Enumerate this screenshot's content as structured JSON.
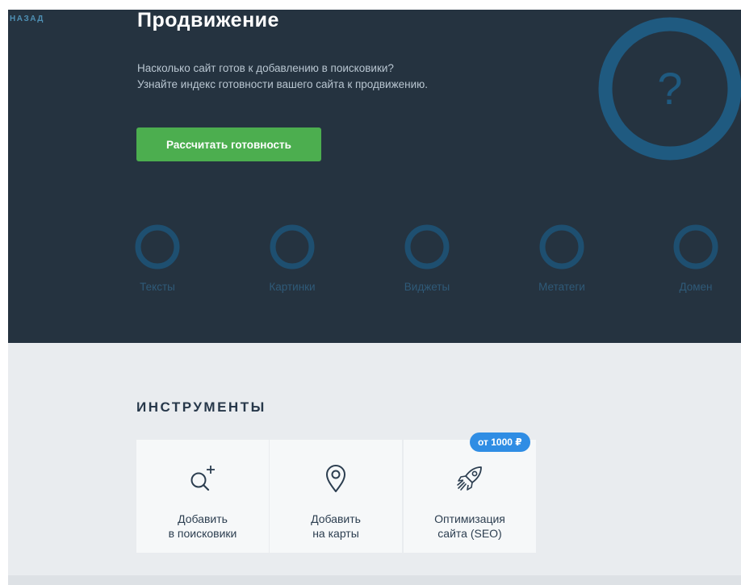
{
  "nav": {
    "back_label": "НАЗАД"
  },
  "hero": {
    "title": "Продвижение",
    "description_line1": "Насколько сайт готов к добавлению в поисковики?",
    "description_line2": "Узнайте индекс готовности вашего сайта к продвижению.",
    "button_label": "Рассчитать готовность",
    "score_symbol": "?"
  },
  "metrics": [
    {
      "label": "Тексты"
    },
    {
      "label": "Картинки"
    },
    {
      "label": "Виджеты"
    },
    {
      "label": "Метатеги"
    },
    {
      "label": "Домен"
    }
  ],
  "tools": {
    "heading": "ИНСТРУМЕНТЫ",
    "items": [
      {
        "icon": "search-plus-icon",
        "line1": "Добавить",
        "line2": "в поисковики"
      },
      {
        "icon": "map-pin-icon",
        "line1": "Добавить",
        "line2": "на карты"
      },
      {
        "icon": "rocket-icon",
        "line1": "Оптимизация",
        "line2": "сайта (SEO)",
        "badge": "от 1000 ₽"
      }
    ]
  },
  "colors": {
    "hero_bg": "#253340",
    "accent_green": "#4cae4f",
    "ring_blue": "#1f5a80",
    "badge_blue": "#2f8de4",
    "section_bg": "#e9ecef"
  }
}
